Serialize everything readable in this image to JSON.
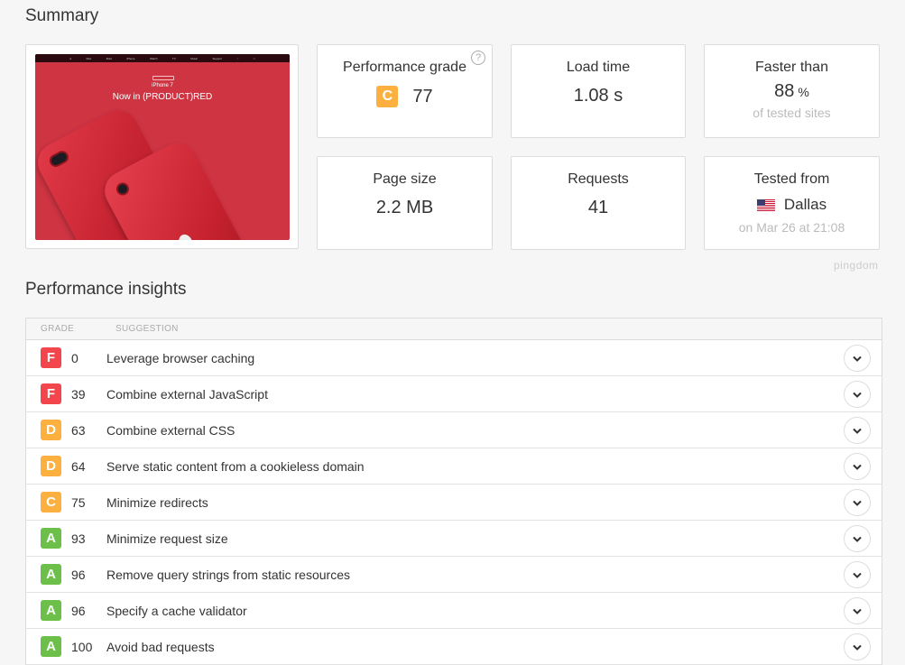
{
  "summary": {
    "title": "Summary",
    "screenshot": {
      "nav_items": [
        "Mac",
        "iPad",
        "iPhone",
        "Watch",
        "TV",
        "Music",
        "Support"
      ],
      "model": "iPhone 7",
      "headline": "Now in (PRODUCT)RED"
    },
    "performance_grade": {
      "label": "Performance grade",
      "grade": "C",
      "value": "77",
      "grade_color": "#fbb040",
      "help": "?"
    },
    "load_time": {
      "label": "Load time",
      "value": "1.08 s"
    },
    "faster_than": {
      "label": "Faster than",
      "value": "88",
      "unit": "%",
      "sub": "of tested sites"
    },
    "page_size": {
      "label": "Page size",
      "value": "2.2 MB"
    },
    "requests": {
      "label": "Requests",
      "value": "41"
    },
    "tested_from": {
      "label": "Tested from",
      "location": "Dallas",
      "flag": "us-flag",
      "date": "on Mar 26 at 21:08"
    },
    "brand": "pingdom"
  },
  "insights": {
    "title": "Performance insights",
    "columns": {
      "grade": "GRADE",
      "suggestion": "SUGGESTION"
    },
    "grade_colors": {
      "A": "#6cc04a",
      "C": "#fbb040",
      "D": "#fbb040",
      "F": "#f2464c"
    },
    "rows": [
      {
        "grade": "F",
        "score": "0",
        "suggestion": "Leverage browser caching"
      },
      {
        "grade": "F",
        "score": "39",
        "suggestion": "Combine external JavaScript"
      },
      {
        "grade": "D",
        "score": "63",
        "suggestion": "Combine external CSS"
      },
      {
        "grade": "D",
        "score": "64",
        "suggestion": "Serve static content from a cookieless domain"
      },
      {
        "grade": "C",
        "score": "75",
        "suggestion": "Minimize redirects"
      },
      {
        "grade": "A",
        "score": "93",
        "suggestion": "Minimize request size"
      },
      {
        "grade": "A",
        "score": "96",
        "suggestion": "Remove query strings from static resources"
      },
      {
        "grade": "A",
        "score": "96",
        "suggestion": "Specify a cache validator"
      },
      {
        "grade": "A",
        "score": "100",
        "suggestion": "Avoid bad requests"
      }
    ]
  }
}
